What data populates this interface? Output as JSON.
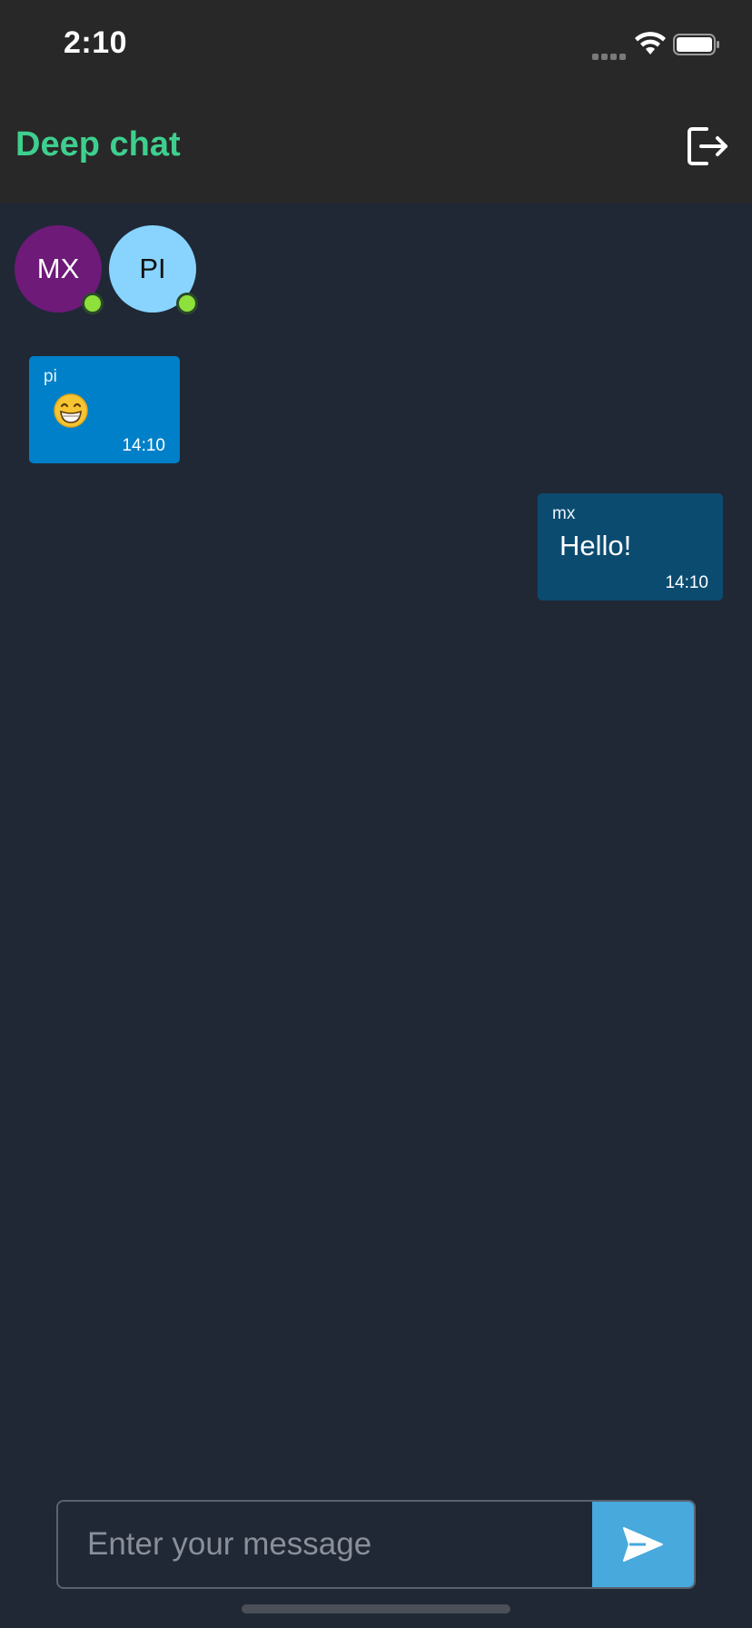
{
  "status_bar": {
    "time": "2:10",
    "icons": [
      "cellular-signal-icon",
      "wifi-icon",
      "battery-icon"
    ]
  },
  "header": {
    "title": "Deep chat",
    "title_color": "#3ecf8e",
    "logout_icon": "logout-icon"
  },
  "users": [
    {
      "initials": "MX",
      "color": "#6d1a78",
      "online": true
    },
    {
      "initials": "PI",
      "color": "#89d4ff",
      "online": true
    }
  ],
  "messages": [
    {
      "sender": "pi",
      "text": "😁",
      "time": "14:10",
      "direction": "incoming",
      "bubble_color": "#0080c8"
    },
    {
      "sender": "mx",
      "text": "Hello!",
      "time": "14:10",
      "direction": "outgoing",
      "bubble_color": "#0c4b70"
    }
  ],
  "composer": {
    "placeholder": "Enter your message",
    "value": "",
    "send_icon": "send-icon",
    "send_color": "#47a9dc"
  }
}
